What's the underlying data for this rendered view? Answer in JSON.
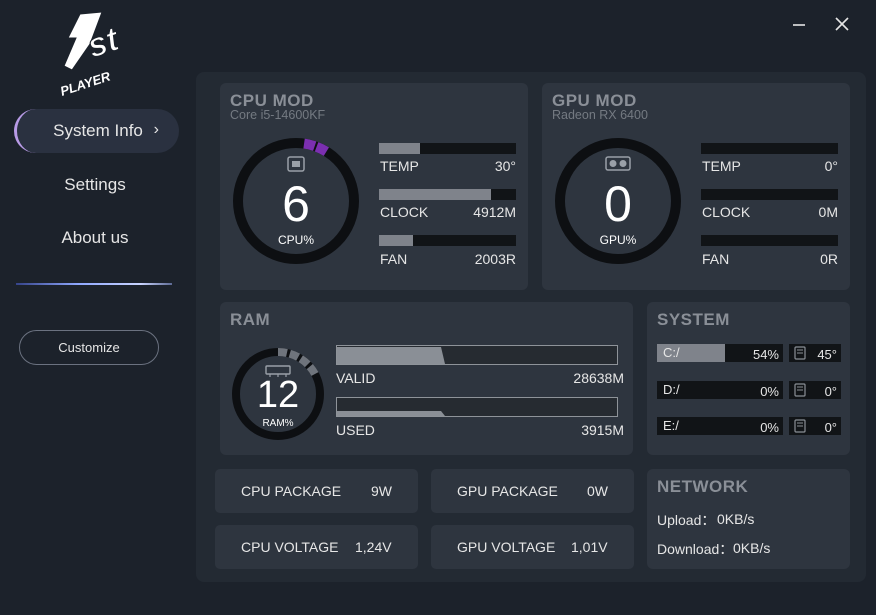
{
  "window": {
    "minimize_icon": "minimize-icon",
    "close_icon": "close-icon"
  },
  "logo": {
    "text_main": "1st",
    "text_sub": "PLAYER"
  },
  "sidebar": {
    "items": [
      {
        "label": "System Info",
        "active": true,
        "chevron": "›"
      },
      {
        "label": "Settings",
        "active": false
      },
      {
        "label": "About us",
        "active": false
      }
    ],
    "customize_label": "Customize"
  },
  "cpu": {
    "title": "CPU MOD",
    "model": "Core i5-14600KF",
    "usage": "6",
    "usage_label": "CPU%",
    "usage_fraction": 0.06,
    "temp_label": "TEMP",
    "temp": "30°",
    "temp_fraction": 0.3,
    "clock_label": "CLOCK",
    "clock": "4912M",
    "clock_fraction": 0.82,
    "fan_label": "FAN",
    "fan": "2003R",
    "fan_fraction": 0.25,
    "accent": "#7b2fb0"
  },
  "gpu": {
    "title": "GPU MOD",
    "model": "Radeon RX 6400",
    "usage": "0",
    "usage_label": "GPU%",
    "temp_label": "TEMP",
    "temp": "0°",
    "clock_label": "CLOCK",
    "clock": "0M",
    "fan_label": "FAN",
    "fan": "0R"
  },
  "ram": {
    "title": "RAM",
    "usage": "12",
    "usage_label": "RAM%",
    "valid_label": "VALID",
    "valid": "28638M",
    "used_label": "USED",
    "used": "3915M"
  },
  "system": {
    "title": "SYSTEM",
    "drives": [
      {
        "name": "C:/",
        "usage": "54%",
        "temp": "45°",
        "usage_fraction": 0.54
      },
      {
        "name": "D:/",
        "usage": "0%",
        "temp": "0°",
        "usage_fraction": 0
      },
      {
        "name": "E:/",
        "usage": "0%",
        "temp": "0°",
        "usage_fraction": 0
      }
    ]
  },
  "power": {
    "cpu_package_label": "CPU PACKAGE",
    "cpu_package": "9W",
    "gpu_package_label": "GPU PACKAGE",
    "gpu_package": "0W",
    "cpu_voltage_label": "CPU VOLTAGE",
    "cpu_voltage": "1,24V",
    "gpu_voltage_label": "GPU VOLTAGE",
    "gpu_voltage": "1,01V"
  },
  "network": {
    "title": "NETWORK",
    "upload_label": "Upload：",
    "upload": "0KB/s",
    "download_label": "Download：",
    "download": "0KB/s"
  }
}
